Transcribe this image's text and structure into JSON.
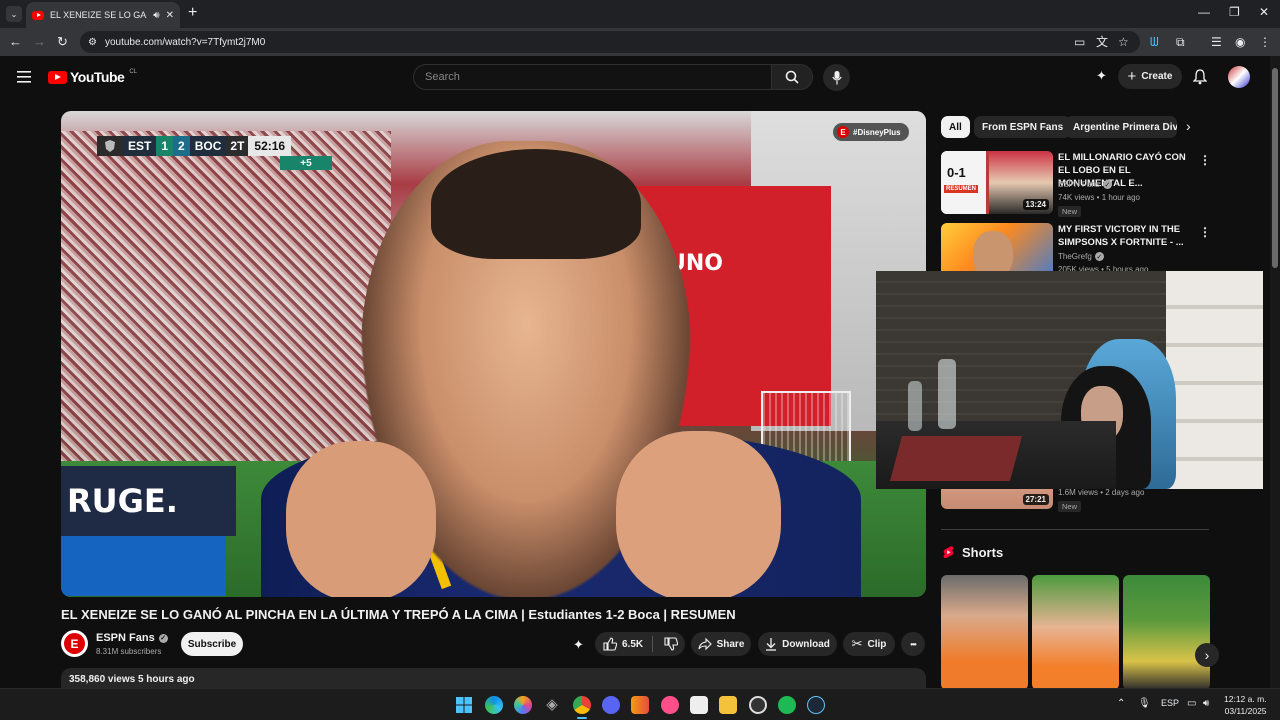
{
  "browser": {
    "tab_title": "EL XENEIZE SE LO GANÓ AL",
    "tab_close": "✕",
    "new_tab": "+",
    "url": "youtube.com/watch?v=7Tfymt2j7M0",
    "window_minimize": "—",
    "window_restore": "❐",
    "window_close": "✕"
  },
  "header": {
    "logo_text": "YouTube",
    "country_code": "CL",
    "search_placeholder": "Search",
    "create_label": "Create"
  },
  "video": {
    "scoreboard": {
      "home": "EST",
      "home_score": "1",
      "away_score": "2",
      "away": "BOC",
      "half": "2T",
      "clock": "52:16",
      "added_time": "+5"
    },
    "broadcast_tag": "#DisneyPlus",
    "stadium_sign": "UNO",
    "ad_board": "RUGE.",
    "title": "EL XENEIZE SE LO GANÓ AL PINCHA EN LA ÚLTIMA Y TREPÓ A LA CIMA | Estudiantes 1-2 Boca | RESUMEN",
    "channel": {
      "name": "ESPN Fans",
      "subscribers": "8.31M subscribers",
      "subscribe_label": "Subscribe",
      "avatar_letter": "E"
    },
    "actions": {
      "likes": "6.5K",
      "share": "Share",
      "download": "Download",
      "clip": "Clip",
      "more": "•••"
    },
    "description_meta": "358,860 views  5 hours ago"
  },
  "sidebar": {
    "chips": [
      "All",
      "From ESPN Fans",
      "Argentine Primera Divisi"
    ],
    "recommendations": [
      {
        "title": "EL MILLONARIO CAYÓ CON EL LOBO EN EL MONUMENTAL E...",
        "channel": "ESPN Fans",
        "meta": "74K views • 1 hour ago",
        "badge": "New",
        "duration": "13:24",
        "thumb_score": "0-1",
        "thumb_tag": "RESUMEN"
      },
      {
        "title": "MY FIRST VICTORY IN THE SIMPSONS X FORTNITE - ...",
        "channel": "TheGrefg",
        "meta": "205K views • 5 hours ago",
        "badge": "",
        "duration": ""
      },
      {
        "title": "",
        "channel": "",
        "meta": "1.6M views • 2 days ago",
        "badge": "New",
        "duration": "27:21"
      }
    ],
    "shorts_title": "Shorts",
    "more_icon": "⋮"
  },
  "taskbar": {
    "language": "ESP",
    "time": "12:12 a. m.",
    "date": "03/11/2025"
  },
  "colors": {
    "background": "#0f0f0f",
    "surface": "#272727",
    "brand_red": "#ff0000",
    "scoreboard_green": "#18856a"
  }
}
